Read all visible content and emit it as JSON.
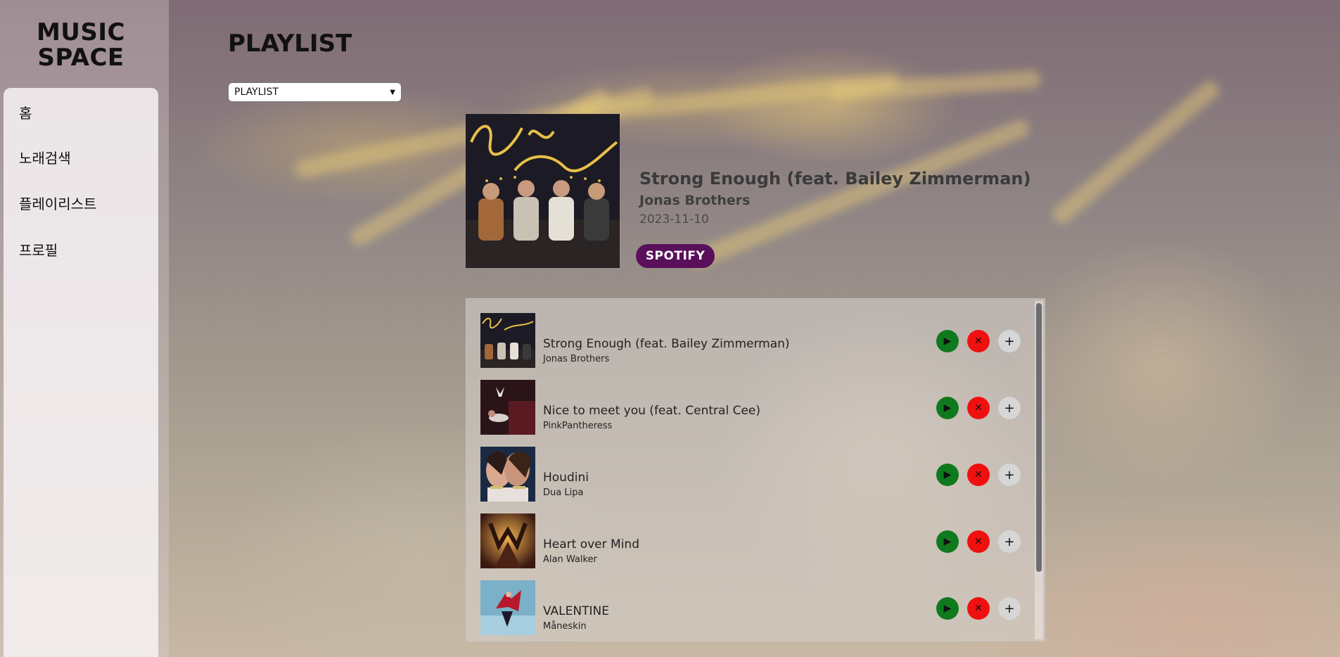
{
  "brand": {
    "line1": "MUSIC",
    "line2": "SPACE"
  },
  "sidebar": {
    "items": [
      {
        "label": "홈"
      },
      {
        "label": "노래검색"
      },
      {
        "label": "플레이리스트"
      },
      {
        "label": "프로필"
      }
    ]
  },
  "main": {
    "title": "PLAYLIST",
    "select": {
      "selected": "PLAYLIST"
    }
  },
  "now_playing": {
    "title": "Strong Enough (feat. Bailey Zimmerman)",
    "artist": "Jonas Brothers",
    "date": "2023-11-10",
    "spotify_label": "SPOTIFY",
    "spotify_color": "#5a0f5a"
  },
  "tracks": [
    {
      "title": "Strong Enough (feat. Bailey Zimmerman)",
      "artist": "Jonas Brothers"
    },
    {
      "title": "Nice to meet you (feat. Central Cee)",
      "artist": "PinkPantheress"
    },
    {
      "title": "Houdini",
      "artist": "Dua Lipa"
    },
    {
      "title": "Heart over Mind",
      "artist": "Alan Walker"
    },
    {
      "title": "VALENTINE",
      "artist": "Måneskin"
    }
  ],
  "controls": {
    "play_icon": "play-icon",
    "remove_icon": "close-icon",
    "add_icon": "plus-icon",
    "play_color": "#0f7a1d",
    "remove_color": "#f01010",
    "add_color": "#d6d6d6"
  }
}
